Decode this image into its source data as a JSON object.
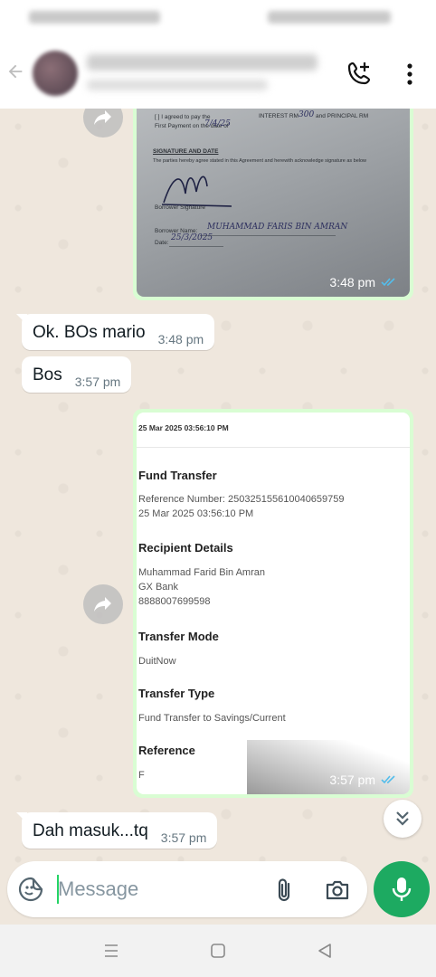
{
  "composer": {
    "placeholder": "Message"
  },
  "messages": [
    {
      "type": "image",
      "direction": "outgoing",
      "content": "signed agreement photo",
      "time": "3:48 pm",
      "status": "read",
      "doc_text": {
        "line1": "[ ] I agreed to pay the",
        "line1b": "INTEREST RM",
        "line1c": "and PRINCIPAL RM",
        "line2": "First Payment on the date of",
        "heading": "SIGNATURE AND DATE",
        "parties": "The parties hereby agree stated in this Agreement and herewith acknowledge signature as below",
        "borrower_sig": "Borrower Signature",
        "borrower_name_label": "Borrower Name:",
        "borrower_name_hand": "MUHAMMAD FARIS BIN AMRAN",
        "date_label": "Date:",
        "date_hand": "25/3/2025",
        "amount_hand": "300",
        "date_hand_top": "7/4/25"
      }
    },
    {
      "type": "text",
      "direction": "incoming",
      "text": "Ok. BOs mario",
      "time": "3:48 pm"
    },
    {
      "type": "text",
      "direction": "incoming",
      "text": "Bos",
      "time": "3:57 pm"
    },
    {
      "type": "image",
      "direction": "outgoing",
      "content": "fund transfer receipt",
      "time": "3:57 pm",
      "status": "read",
      "receipt": {
        "date": "25 Mar 2025 03:56:10 PM",
        "title": "Fund Transfer",
        "reference_number": "Reference Number: 250325155610040659759",
        "reference_date": "25 Mar 2025 03:56:10 PM",
        "recipient_heading": "Recipient Details",
        "recipient_name": "Muhammad Farid Bin Amran",
        "recipient_bank": "GX Bank",
        "recipient_account": "8888007699598",
        "mode_heading": "Transfer Mode",
        "mode_value": "DuitNow",
        "type_heading": "Transfer Type",
        "type_value": "Fund Transfer to Savings/Current",
        "ref_heading": "Reference",
        "ref_value": "F"
      }
    },
    {
      "type": "text",
      "direction": "incoming",
      "text": "Dah masuk...tq",
      "time": "3:57 pm"
    }
  ],
  "colors": {
    "chat_bg": "#efe7dd",
    "outgoing_bubble": "#d9fdd3",
    "incoming_bubble": "#ffffff",
    "accent_green": "#1daa61",
    "read_ticks": "#53bdeb"
  },
  "icons": {
    "header": [
      "back-arrow-icon",
      "add-call-icon",
      "more-vertical-icon"
    ],
    "composer": [
      "emoji-sticker-icon",
      "attach-paperclip-icon",
      "camera-icon",
      "mic-icon"
    ],
    "nav": [
      "recents-icon",
      "home-icon",
      "back-triangle-icon"
    ]
  }
}
